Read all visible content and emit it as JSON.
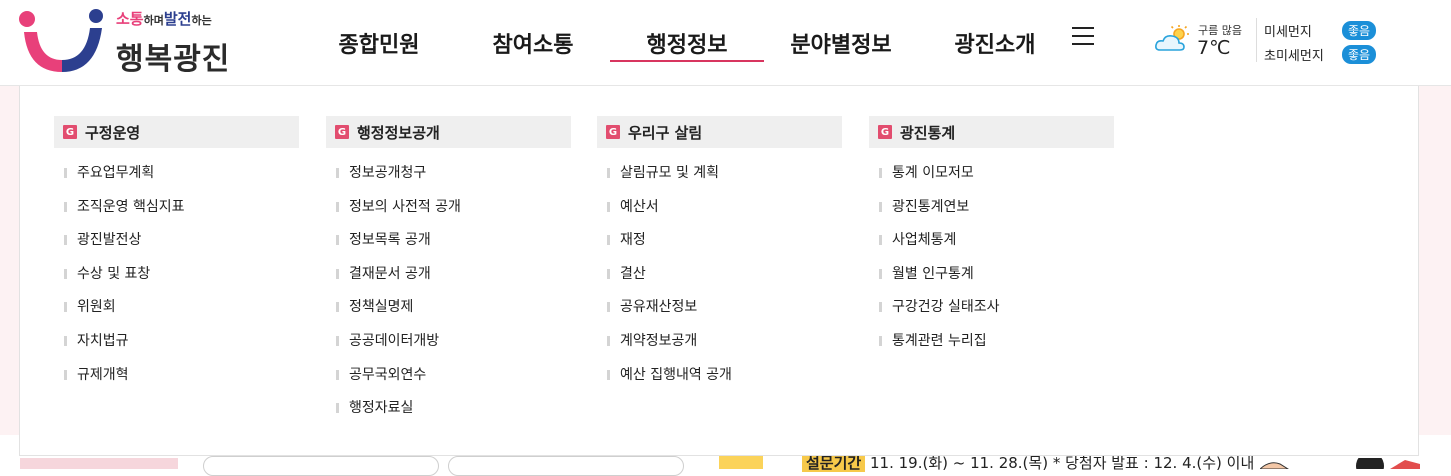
{
  "logo": {
    "tagline_pink": "소통",
    "tagline_small1": "하며",
    "tagline_blue": "발전",
    "tagline_small2": "하는",
    "title": "행복광진"
  },
  "nav": {
    "items": [
      {
        "label": "종합민원",
        "active": false
      },
      {
        "label": "참여소통",
        "active": false
      },
      {
        "label": "행정정보",
        "active": true
      },
      {
        "label": "분야별정보",
        "active": false
      },
      {
        "label": "광진소개",
        "active": false
      }
    ],
    "menu_icon": "hamburger-icon"
  },
  "weather": {
    "icon": "cloud-sun-icon",
    "desc": "구름 많음",
    "temp": "7℃"
  },
  "air": {
    "fine_dust_label": "미세먼지",
    "fine_dust_status": "좋음",
    "ultrafine_dust_label": "초미세먼지",
    "ultrafine_dust_status": "좋음"
  },
  "dropdown": {
    "columns": [
      {
        "icon_letter": "G",
        "title": "구정운영",
        "items": [
          "주요업무계획",
          "조직운영 핵심지표",
          "광진발전상",
          "수상 및 표창",
          "위원회",
          "자치법규",
          "규제개혁"
        ]
      },
      {
        "icon_letter": "G",
        "title": "행정정보공개",
        "items": [
          "정보공개청구",
          "정보의 사전적 공개",
          "정보목록 공개",
          "결재문서 공개",
          "정책실명제",
          "공공데이터개방",
          "공무국외연수",
          "행정자료실"
        ]
      },
      {
        "icon_letter": "G",
        "title": "우리구 살림",
        "items": [
          "살림규모 및 계획",
          "예산서",
          "재정",
          "결산",
          "공유재산정보",
          "계약정보공개",
          "예산 집행내역 공개"
        ]
      },
      {
        "icon_letter": "G",
        "title": "광진통계",
        "items": [
          "통계 이모저모",
          "광진통계연보",
          "사업체통계",
          "월별 인구통계",
          "구강건강 실태조사",
          "통계관련 누리집"
        ]
      }
    ]
  },
  "bottom": {
    "badge": "설문기간",
    "text": "11. 19.(화) ~ 11. 28.(목) * 당첨자 발표 : 12. 4.(수) 이내"
  },
  "colors": {
    "accent": "#e24d6f",
    "active_underline": "#d8355f",
    "badge_blue": "#1b8fd8"
  }
}
